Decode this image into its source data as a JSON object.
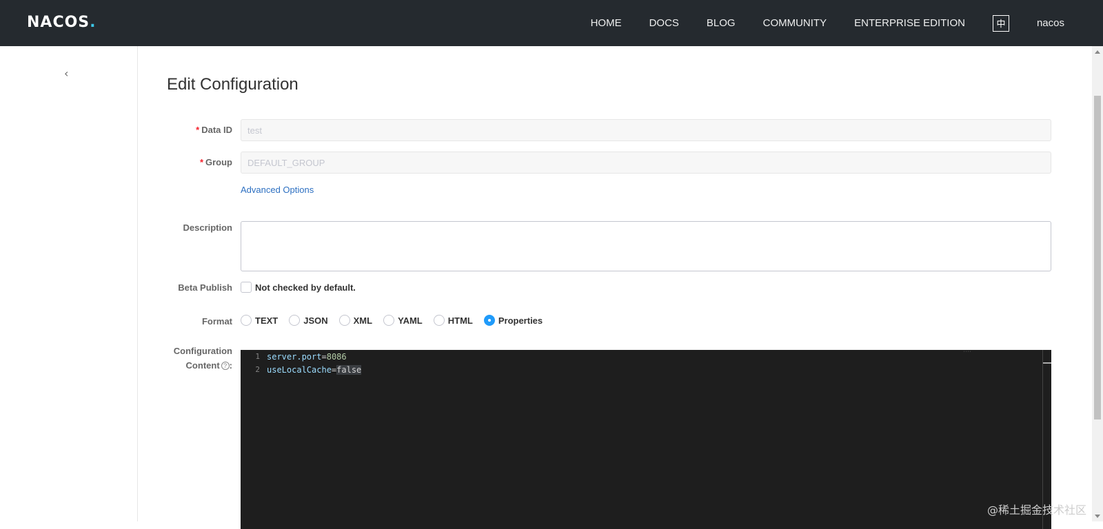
{
  "header": {
    "logo": "NACOS.",
    "nav": [
      "HOME",
      "DOCS",
      "BLOG",
      "COMMUNITY",
      "ENTERPRISE EDITION"
    ],
    "lang": "中",
    "user": "nacos"
  },
  "sidebar": {
    "collapse_icon": "chevron-left-icon"
  },
  "page": {
    "title": "Edit Configuration",
    "data_id": {
      "label": "Data ID",
      "value": "test"
    },
    "group": {
      "label": "Group",
      "value": "DEFAULT_GROUP"
    },
    "advanced_options": "Advanced Options",
    "description": {
      "label": "Description",
      "value": ""
    },
    "beta": {
      "label": "Beta Publish",
      "text": "Not checked by default."
    },
    "format": {
      "label": "Format",
      "options": [
        "TEXT",
        "JSON",
        "XML",
        "YAML",
        "HTML",
        "Properties"
      ],
      "selected": "Properties"
    },
    "content": {
      "label_line1": "Configuration",
      "label_line2": "Content",
      "help": "?",
      "colon": ":",
      "lines": [
        {
          "no": "1",
          "key": "server.port",
          "eq": "=",
          "val": "8086"
        },
        {
          "no": "2",
          "key": "useLocalCache",
          "eq": "=",
          "val": "false"
        }
      ]
    }
  },
  "watermark": "@稀土掘金技术社区"
}
